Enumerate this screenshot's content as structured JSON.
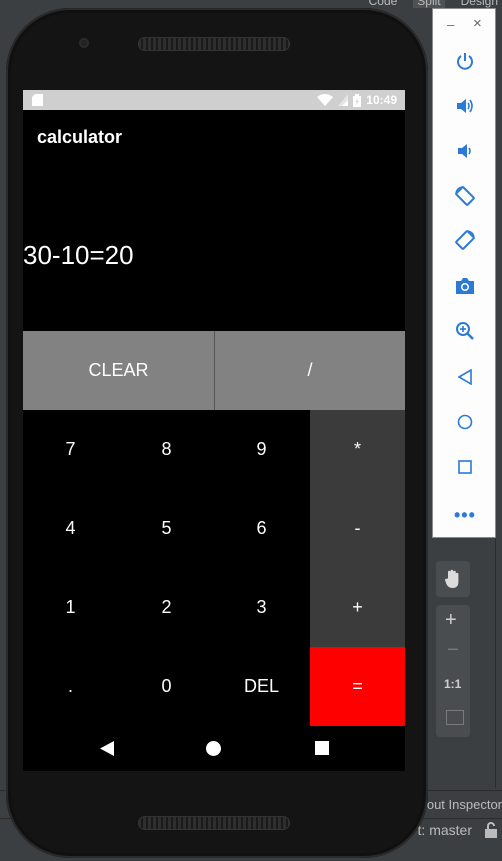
{
  "ide": {
    "tabs": [
      "Code",
      "Split",
      "Design"
    ],
    "bottom": {
      "layout_inspector": "out Inspector",
      "git_branch": "t: master"
    }
  },
  "emulator_controls": {
    "minimize_label": "–",
    "close_label": "×",
    "more_label": "•••",
    "buttons": [
      "power-icon",
      "volume-up-icon",
      "volume-down-icon",
      "rotate-left-icon",
      "rotate-right-icon",
      "camera-icon",
      "zoom-icon",
      "back-icon",
      "home-icon",
      "overview-icon"
    ]
  },
  "ide_tools": {
    "zoom_in": "+",
    "zoom_out": "−",
    "zoom_actual": "1:1"
  },
  "device": {
    "status_bar": {
      "time": "10:49"
    },
    "app": {
      "title": "calculator",
      "display": "30-10=20",
      "buttons": {
        "clear": "CLEAR",
        "divide": "/",
        "seven": "7",
        "eight": "8",
        "nine": "9",
        "multiply": "*",
        "four": "4",
        "five": "5",
        "six": "6",
        "minus": "-",
        "one": "1",
        "two": "2",
        "three": "3",
        "plus": "+",
        "dot": ".",
        "zero": "0",
        "del": "DEL",
        "equals": "="
      }
    }
  },
  "colors": {
    "equals_button": "#ff0000",
    "grey_button": "#828282",
    "operator_button": "#3b3b3b",
    "emulator_icon": "#2b7bd6"
  }
}
